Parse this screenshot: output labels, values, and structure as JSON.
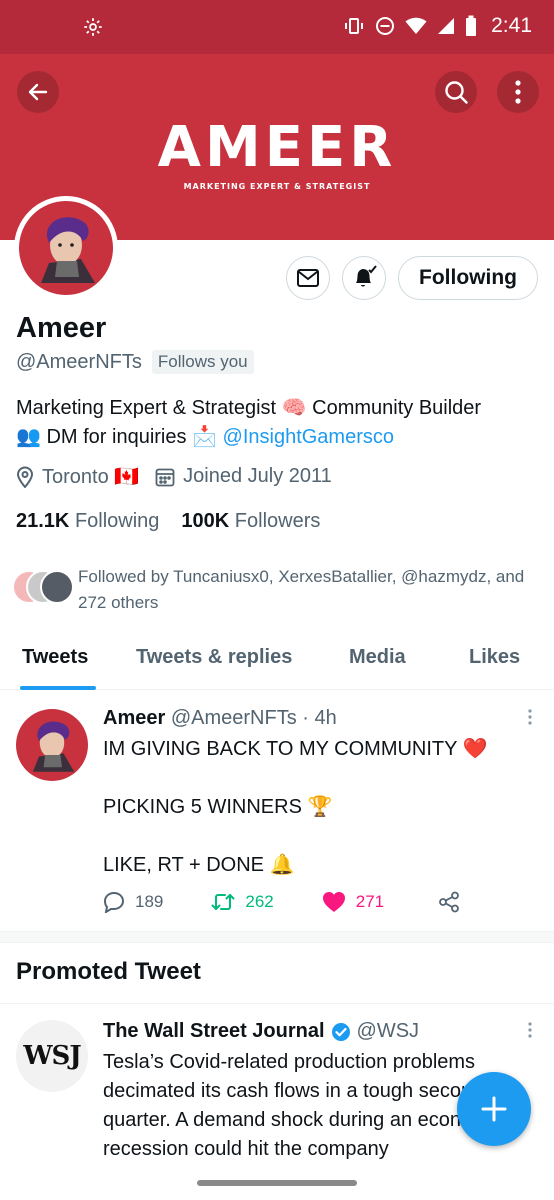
{
  "status_bar": {
    "time": "2:41"
  },
  "banner": {
    "brand": "AMEER",
    "tagline": "MARKETING EXPERT & STRATEGIST",
    "color": "#c8323f"
  },
  "profile": {
    "name": "Ameer",
    "handle": "@AmeerNFTs",
    "follows_you": "Follows you",
    "follow_button": "Following",
    "bio_line1": "Marketing Expert & Strategist 🧠 Community Builder",
    "bio_line2_prefix": "👥 DM for inquiries 📩 ",
    "bio_link": "@InsightGamersco",
    "location": "Toronto 🇨🇦",
    "joined": "Joined July 2011",
    "following_count": "21.1K",
    "following_label": "Following",
    "followers_count": "100K",
    "followers_label": "Followers",
    "followed_by": "Followed by Tuncaniusx0, XerxesBatallier, @hazmydz, and 272 others"
  },
  "tabs": [
    {
      "label": "Tweets"
    },
    {
      "label": "Tweets & replies"
    },
    {
      "label": "Media"
    },
    {
      "label": "Likes"
    }
  ],
  "tweet": {
    "author": "Ameer",
    "handle_time": "@AmeerNFTs · 4h",
    "line1": "IM GIVING BACK TO MY COMMUNITY ❤️",
    "line2": "PICKING 5 WINNERS 🏆",
    "line3": "LIKE, RT + DONE 🔔",
    "replies": "189",
    "retweets": "262",
    "likes": "271"
  },
  "promoted": {
    "heading": "Promoted Tweet",
    "avatar_text": "WSJ",
    "author": "The Wall Street Journal",
    "handle": "@WSJ",
    "body": "Tesla’s Covid-related production problems decimated its cash flows in a tough second quarter. A demand shock during an economic recession could hit the company"
  },
  "colors": {
    "accent": "#1d9bf0",
    "retweet": "#00ba7c",
    "like": "#f91880"
  }
}
